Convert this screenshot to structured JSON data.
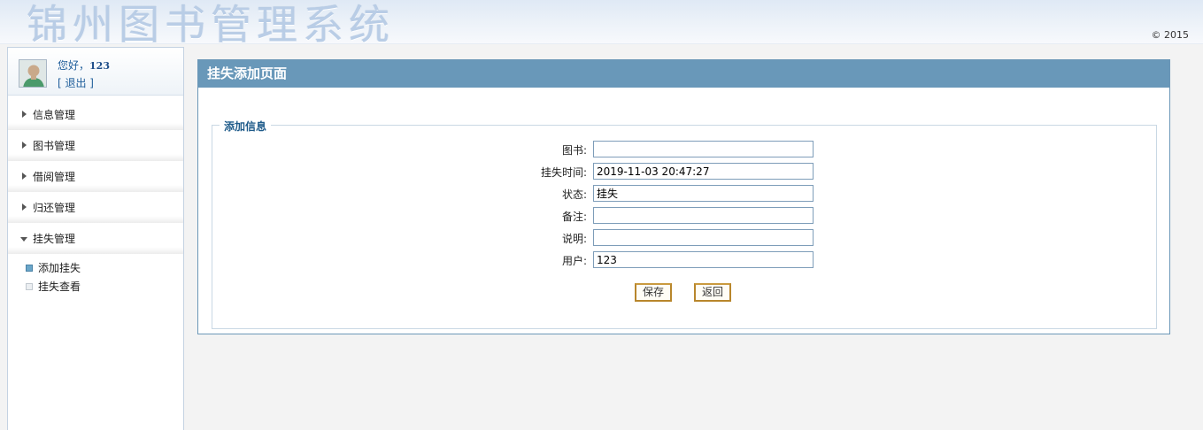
{
  "header": {
    "title": "锦州图书管理系统",
    "copyright": "© 2015"
  },
  "user": {
    "greeting": "您好，",
    "name": "123",
    "logout": "[ 退出 ]"
  },
  "menu": [
    {
      "label": "信息管理",
      "open": false
    },
    {
      "label": "图书管理",
      "open": false
    },
    {
      "label": "借阅管理",
      "open": false
    },
    {
      "label": "归还管理",
      "open": false
    },
    {
      "label": "挂失管理",
      "open": true
    }
  ],
  "submenu": [
    {
      "label": "添加挂失",
      "active": true
    },
    {
      "label": "挂失查看",
      "active": false
    }
  ],
  "panel": {
    "title": "挂失添加页面",
    "legend": "添加信息"
  },
  "form": [
    {
      "label": "图书:",
      "value": ""
    },
    {
      "label": "挂失时间:",
      "value": "2019-11-03 20:47:27"
    },
    {
      "label": "状态:",
      "value": "挂失"
    },
    {
      "label": "备注:",
      "value": ""
    },
    {
      "label": "说明:",
      "value": ""
    },
    {
      "label": "用户:",
      "value": "123"
    }
  ],
  "buttons": {
    "save": "保存",
    "back": "返回"
  }
}
